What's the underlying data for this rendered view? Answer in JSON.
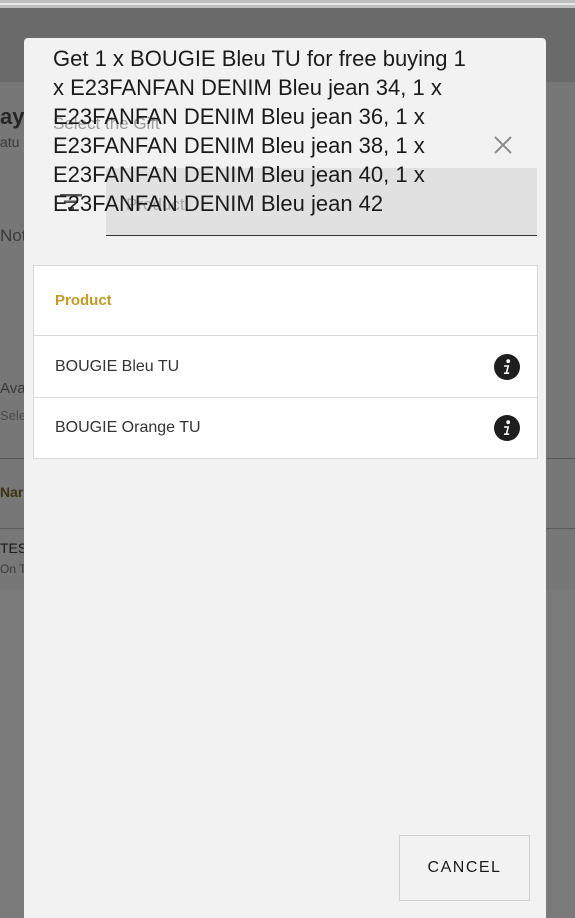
{
  "background": {
    "title_fragment": "ayr",
    "subtitle_fragment": "atu",
    "note_fragment": "Not",
    "available_fragment": "Ava",
    "select_fragment": "Sele",
    "name_header_fragment": "Nar",
    "row_title_fragment": "TES",
    "row_sub_fragment": "On T"
  },
  "dialog": {
    "title": "Get 1 x BOUGIE Bleu TU for free buying 1 x E23FANFAN DENIM Bleu jean 34, 1 x E23FANFAN DENIM Bleu jean 36, 1 x E23FANFAN DENIM Bleu jean 38, 1 x E23FANFAN DENIM Bleu jean 40, 1 x E23FANFAN DENIM Bleu jean 42",
    "select_label": "Select the Gift",
    "search": {
      "placeholder": "Product",
      "value": ""
    },
    "table": {
      "header": "Product",
      "rows": [
        {
          "name": "BOUGIE Bleu TU",
          "icon": "info-icon"
        },
        {
          "name": "BOUGIE Orange TU",
          "icon": "info-icon"
        }
      ]
    },
    "cancel_label": "CANCEL",
    "icons": {
      "close": "close-icon",
      "filter": "filter-icon"
    },
    "colors": {
      "accent": "#c49a26",
      "dialog_bg": "#f2f2f2",
      "search_bg": "#e1e1e1"
    }
  }
}
